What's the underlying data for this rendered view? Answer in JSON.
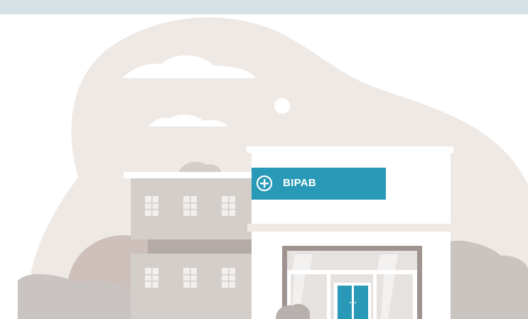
{
  "hospital_sign": {
    "text": "BIPAB",
    "icon": "medical-plus-icon"
  },
  "colors": {
    "top_bar": "#d6e2e6",
    "background_blob": "#efe9e6",
    "accent_teal": "#2899b6",
    "building_light": "#d2cfcc",
    "building_dark": "#b3aaa6",
    "bush": "#c8bdb8",
    "door_frame": "#9e948f"
  }
}
